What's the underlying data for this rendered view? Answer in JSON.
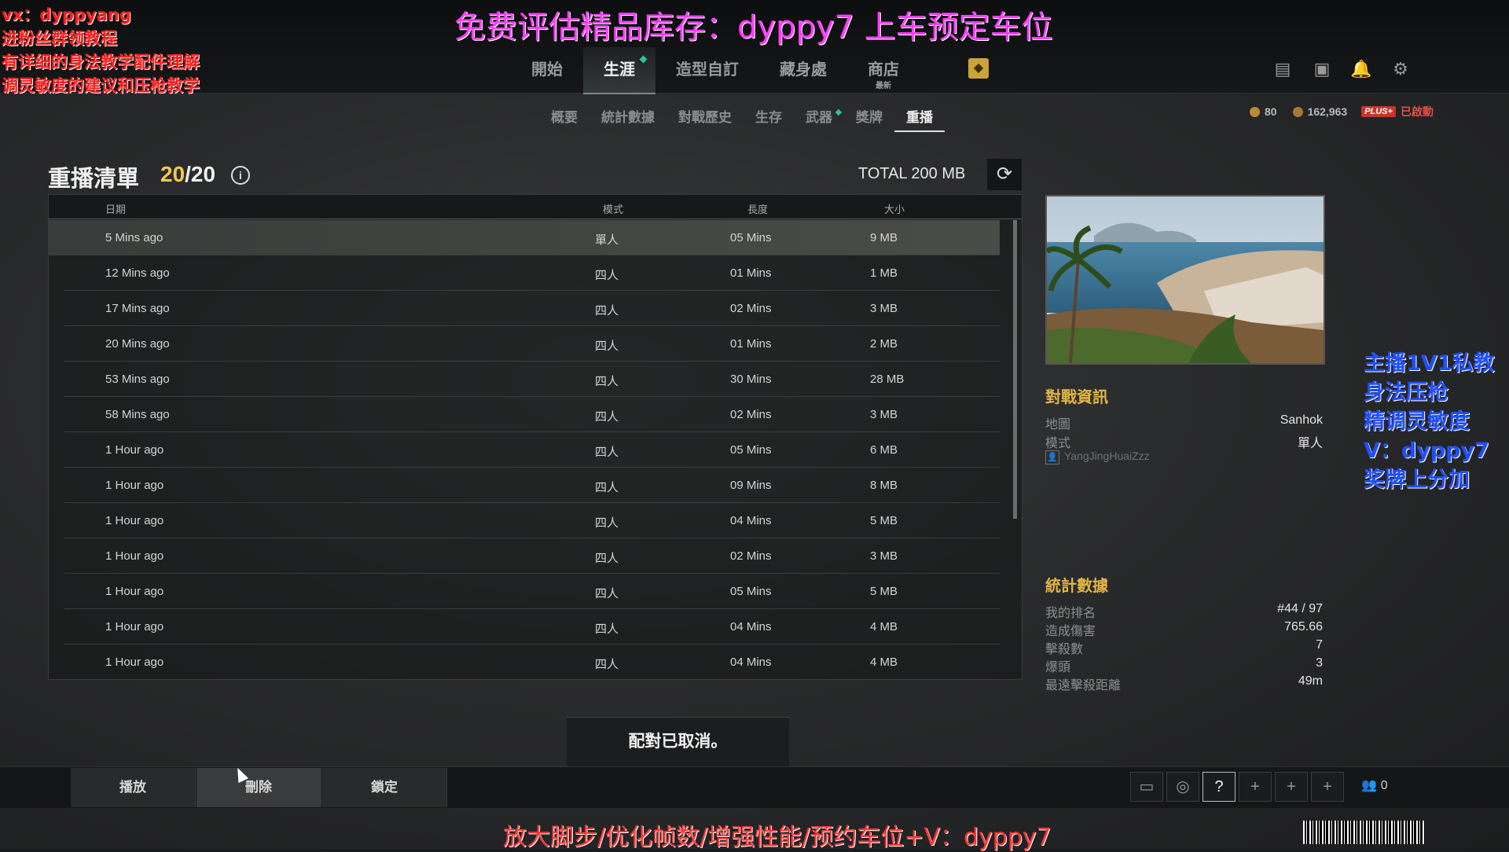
{
  "overlays": {
    "top_banner": "免费评估精品库存：dyppy7   上车预定车位",
    "left_lines": [
      "vx：dyppyang",
      "进粉丝群领教程",
      "有详细的身法教学配件理解",
      "调灵敏度的建议和压枪教学"
    ],
    "right_lines": [
      "主播1V1私教",
      "身法压枪",
      "精调灵敏度",
      "V：dyppy7",
      "奖牌上分加"
    ],
    "bottom_banner": "放大脚步/优化帧数/增强性能/预约车位+V：dyppy7"
  },
  "main_nav": [
    {
      "label": "開始"
    },
    {
      "label": "生涯",
      "active": true
    },
    {
      "label": "造型自訂"
    },
    {
      "label": "藏身處"
    },
    {
      "label": "商店",
      "tag": "最新"
    }
  ],
  "sub_nav": [
    "概要",
    "統計數據",
    "對戰歷史",
    "生存",
    "武器",
    "獎牌",
    "重播"
  ],
  "currency": {
    "coins": "80",
    "bp": "162,963",
    "plus": "PLUS+",
    "status": "已啟動"
  },
  "replay": {
    "title": "重播清單",
    "count": "20",
    "count_max": "/20",
    "total": "TOTAL 200 MB",
    "columns": {
      "date": "日期",
      "mode": "模式",
      "length": "長度",
      "size": "大小"
    },
    "rows": [
      {
        "date": "5 Mins ago",
        "mode": "單人",
        "length": "05 Mins",
        "size": "9 MB"
      },
      {
        "date": "12 Mins ago",
        "mode": "四人",
        "length": "01 Mins",
        "size": "1 MB"
      },
      {
        "date": "17 Mins ago",
        "mode": "四人",
        "length": "02 Mins",
        "size": "3 MB"
      },
      {
        "date": "20 Mins ago",
        "mode": "四人",
        "length": "01 Mins",
        "size": "2 MB"
      },
      {
        "date": "53 Mins ago",
        "mode": "四人",
        "length": "30 Mins",
        "size": "28 MB"
      },
      {
        "date": "58 Mins ago",
        "mode": "四人",
        "length": "02 Mins",
        "size": "3 MB"
      },
      {
        "date": "1 Hour ago",
        "mode": "四人",
        "length": "05 Mins",
        "size": "6 MB"
      },
      {
        "date": "1 Hour ago",
        "mode": "四人",
        "length": "09 Mins",
        "size": "8 MB"
      },
      {
        "date": "1 Hour ago",
        "mode": "四人",
        "length": "04 Mins",
        "size": "5 MB"
      },
      {
        "date": "1 Hour ago",
        "mode": "四人",
        "length": "02 Mins",
        "size": "3 MB"
      },
      {
        "date": "1 Hour ago",
        "mode": "四人",
        "length": "05 Mins",
        "size": "5 MB"
      },
      {
        "date": "1 Hour ago",
        "mode": "四人",
        "length": "04 Mins",
        "size": "4 MB"
      },
      {
        "date": "1 Hour ago",
        "mode": "四人",
        "length": "04 Mins",
        "size": "4 MB"
      }
    ]
  },
  "match_info": {
    "heading": "對戰資訊",
    "map_label": "地圖",
    "map_value": "Sanhok",
    "mode_label": "模式",
    "mode_value": "單人",
    "player": "YangJingHuaiZzz"
  },
  "stats": {
    "heading": "統計數據",
    "items": [
      {
        "label": "我的排名",
        "value": "#44 / 97"
      },
      {
        "label": "造成傷害",
        "value": "765.66"
      },
      {
        "label": "擊殺數",
        "value": "7"
      },
      {
        "label": "爆頭",
        "value": "3"
      },
      {
        "label": "最遠擊殺距離",
        "value": "49m"
      }
    ]
  },
  "toast": "配對已取消。",
  "actions": {
    "play": "播放",
    "delete": "刪除",
    "lock": "鎖定"
  },
  "party_count": "0"
}
